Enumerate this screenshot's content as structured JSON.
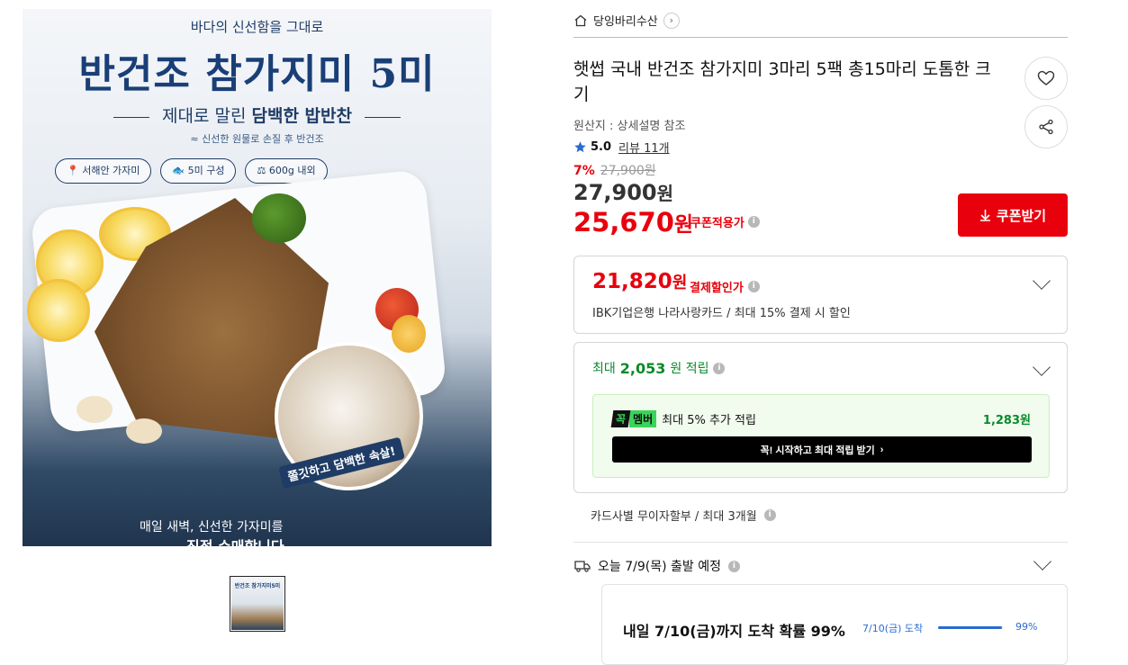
{
  "hero": {
    "subtitle": "바다의 신선함을 그대로",
    "title": "반건조 참가지미 5미",
    "tagline_plain": "제대로 말린",
    "tagline_bold": "담백한 밥반찬",
    "note": "신선한 원물로 손질 후 반건조",
    "pills": [
      "서해안 가자미",
      "5미 구성",
      "600g 내외"
    ],
    "zoom_caption": "쫄깃하고 담백한 속살!",
    "bottom_line1": "매일 새벽, 신선한 가자미를",
    "bottom_line2": "직접 수매합니다."
  },
  "thumbnail": {
    "label": "반건조 참가지미5미"
  },
  "store": {
    "name": "당잉바리수산",
    "chevron": "›"
  },
  "product": {
    "title": "햇썹 국내 반건조 참가지미 3마리 5팩 총15마리 도톰한 크기",
    "origin": "원산지 : 상세설명 참조",
    "rating": "5.0",
    "reviews": "리뷰 11개",
    "discount_pct": "7%",
    "original_price": "27,900원",
    "price": "27,900",
    "price_unit": "원",
    "coupon_price": "25,670",
    "coupon_unit": "원",
    "coupon_label": "쿠폰적용가",
    "coupon_button": "쿠폰받기"
  },
  "payment": {
    "price": "21,820",
    "unit": "원",
    "label": "결제할인가",
    "desc": "IBK기업은행 나라사랑카드 / 최대 15% 결제 시 할인"
  },
  "points": {
    "prefix": "최대",
    "amount": "2,053",
    "suffix": "원 적립",
    "member_logo_a": "꼭",
    "member_logo_b": "멤버",
    "member_text": "최대 5% 추가 적립",
    "member_amount": "1,283원",
    "member_button": "꼭! 시작하고 최대 적립 받기",
    "member_button_arrow": "›"
  },
  "installment": "카드사별 무이자할부 / 최대 3개월",
  "shipping": {
    "depart": "오늘 7/9(목) 출발 예정",
    "arrive": "내일 7/10(금)까지 도착 확률 99%",
    "arrive_date": "7/10(금) 도착",
    "arrive_pct": "99%",
    "arrive_fraction": 0.99
  },
  "colors": {
    "accent_red": "#e8000d",
    "point_green": "#0a8a2a",
    "ship_blue": "#2a6bd1"
  }
}
